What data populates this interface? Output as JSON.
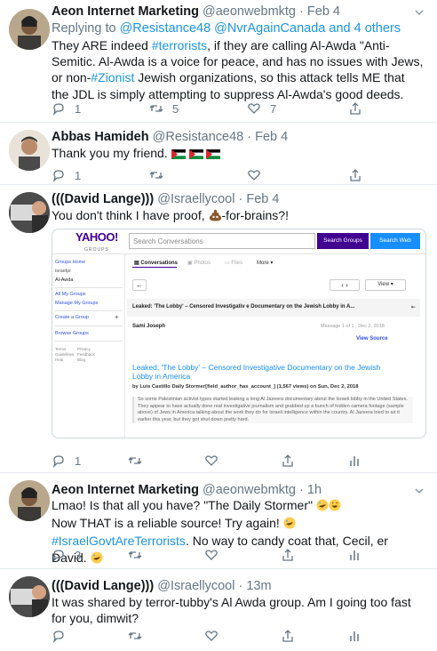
{
  "tweets": [
    {
      "name": "Aeon Internet Marketing",
      "handle": "@aeonwebmktg",
      "sep": "·",
      "time": "Feb 4",
      "replying_prefix": "Replying to ",
      "replying_users": "@Resistance48 @NvrAgainCanada",
      "replying_more": "and 4 others",
      "text_1": "They ARE indeed ",
      "hashtag_1": "#terrorists",
      "text_2": ", if they are calling Al-Awda \"Anti-Semitic.  Al-Awda is a voice for peace, and has no issues with Jews, or non-",
      "hashtag_2": "#Zionist",
      "text_3": " Jewish organizations, so this attack tells ME that the JDL is simply attempting to suppress Al-Awda's good deeds.",
      "reply_count": "1",
      "retweet_count": "5",
      "like_count": "7"
    },
    {
      "name": "Abbas Hamideh",
      "handle": "@Resistance48",
      "sep": "·",
      "time": "Feb 4",
      "text": "Thank you my friend. ",
      "reply_count": "1",
      "retweet_count": "",
      "like_count": ""
    },
    {
      "name": "(((David Lange)))",
      "handle": "@Israellycool",
      "sep": "·",
      "time": "Feb 4",
      "text_1": "You don't think I have proof, ",
      "text_2": "-for-brains?!",
      "reply_count": "1",
      "retweet_count": "",
      "like_count": ""
    },
    {
      "name": "Aeon Internet Marketing",
      "handle": "@aeonwebmktg",
      "sep": "·",
      "time": "1h",
      "line_1": "Lmao!  Is that all you have?  \"The Daily Stormer\" ",
      "line_2": "Now THAT is a reliable source!  Try again! ",
      "hashtag": "#IsraelGovtAreTerrorists",
      "line_2_end": ". No way to candy coat that, Cecil, er David.  ",
      "reply_count": "3",
      "retweet_count": "",
      "like_count": ""
    },
    {
      "name": "(((David Lange)))",
      "handle": "@Israellycool",
      "sep": "·",
      "time": "13m",
      "text": "It was shared by terror-tubby's Al Awda group. Am I going too fast for you, dimwit?",
      "reply_count": "",
      "retweet_count": "",
      "like_count": ""
    }
  ],
  "embed": {
    "logo": "YAHOO!",
    "logo_sub": "GROUPS",
    "search_placeholder": "Search Conversations",
    "search_groups": "Search Groups",
    "search_web": "Search Web",
    "sidebar": [
      "Groups Home",
      "israelpr",
      "Al-Awda",
      "All My Groups",
      "Manage My Groups",
      "Create a Group",
      "+",
      "Browse Groups"
    ],
    "footer_left": [
      "Terms",
      "Guidelines",
      "Help"
    ],
    "footer_right": [
      "Privacy",
      "Feedback",
      "Blog"
    ],
    "tabs": [
      "Conversations",
      "Photos",
      "Files",
      "More"
    ],
    "view": "View",
    "subject": "Leaked: 'The Lobby' – Censored Investigativ e Documentary on the Jewish Lobby in A...",
    "sender": "Sami Joseph",
    "msg_meta": "Message 1 of 1 , Dec 2, 2018",
    "view_source": "View Source",
    "article_title": "Leaked: 'The Lobby' – Censored Investigative Documentary on the Jewish Lobby in America",
    "byline": "by Luis Castillo Daily Stormer[field_author_has_account_] (1,567 views) on Sun, Dec 2, 2018",
    "paragraph": "So some Palestinian activist types started leaking a long Al Jazeera documentary about the Israeli lobby in the United States. They appear to have actually done real investigative journalism and grabbed up a bunch of hidden camera footage (sample above) of Jews in America talking about the work they do for Israeli intelligence within the country. Al Jazeera tried to air it earlier this year, but they got shut down pretty hard."
  },
  "colors": {
    "link": "#1b95e0",
    "muted": "#657786",
    "yahoo_purple": "#400090",
    "yahoo_blue": "#188fff"
  }
}
